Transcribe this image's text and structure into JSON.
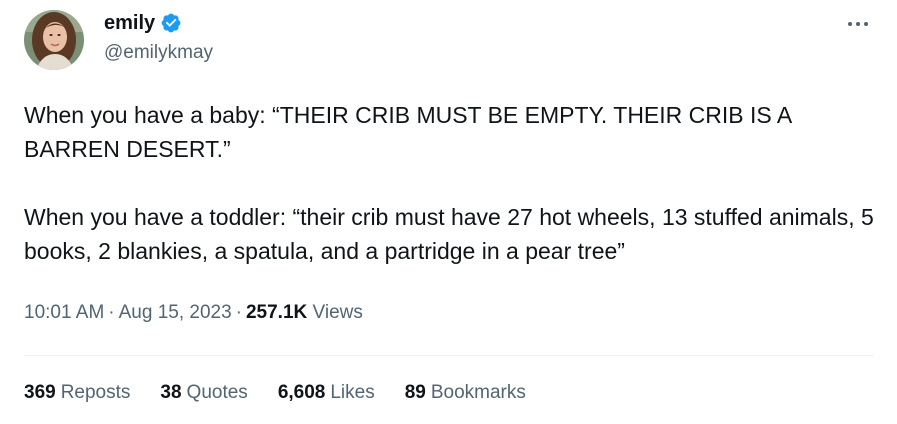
{
  "author": {
    "display_name": "emily",
    "handle": "@emilykmay",
    "verified_icon": "verified-badge-icon",
    "avatar_icon": "avatar-photo"
  },
  "menu_icon": "more-horizontal-icon",
  "tweet": {
    "paragraphs": [
      "When you have a baby: “THEIR CRIB MUST BE EMPTY. THEIR CRIB IS A BARREN DESERT.”",
      "When you have a toddler: “their crib must have 27 hot wheels, 13 stuffed animals, 5 books, 2 blankies, a spatula, and a partridge in a pear tree”"
    ]
  },
  "meta": {
    "time": "10:01 AM",
    "separator": "·",
    "date": "Aug 15, 2023",
    "views_count": "257.1K",
    "views_label": "Views"
  },
  "stats": [
    {
      "count": "369",
      "label": "Reposts"
    },
    {
      "count": "38",
      "label": "Quotes"
    },
    {
      "count": "6,608",
      "label": "Likes"
    },
    {
      "count": "89",
      "label": "Bookmarks"
    }
  ],
  "colors": {
    "text_primary": "#0f1419",
    "text_secondary": "#536471",
    "verified_blue": "#1d9bf0",
    "divider": "#eff3f4"
  }
}
